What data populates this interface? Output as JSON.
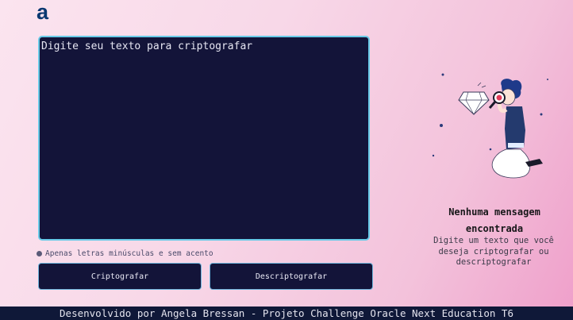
{
  "logo": {
    "text": "a"
  },
  "editor": {
    "placeholder": "Digite seu texto para criptografar"
  },
  "hint": {
    "text": "Apenas letras minúsculas e sem acento"
  },
  "buttons": {
    "encrypt": "Criptografar",
    "decrypt": "Descriptografar"
  },
  "output": {
    "title": "Nenhuma mensagem encontrada",
    "subtitle": "Digite um texto que você deseja criptografar ou descriptografar"
  },
  "footer": {
    "text": "Desenvolvido por Angela Bressan - Projeto Challenge Oracle Next Education T6"
  },
  "colors": {
    "brand": "#0a3871",
    "panel": "#131439",
    "panel_border": "#68cbe8"
  }
}
